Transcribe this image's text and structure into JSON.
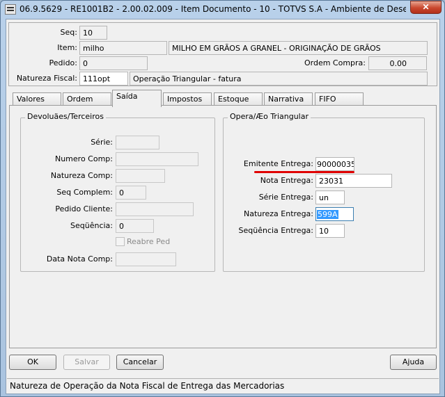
{
  "window": {
    "title": "06.9.5629 - RE1001B2 - 2.00.02.009 - Item Documento - 10 - TOTVS S.A - Ambiente de Desenvolviment...",
    "close_symbol": "✕"
  },
  "header": {
    "seq": {
      "label": "Seq:",
      "value": "10"
    },
    "item": {
      "label": "Item:",
      "value": "milho",
      "description": "MILHO EM GRÃOS A GRANEL - ORIGINAÇÃO DE GRÃOS"
    },
    "pedido": {
      "label": "Pedido:",
      "value": "0"
    },
    "ordem_compra": {
      "label": "Ordem Compra:",
      "value": "0.00"
    },
    "natureza_fiscal": {
      "label": "Natureza Fiscal:",
      "value": "111opt",
      "description": "Operação Triangular - fatura"
    }
  },
  "tabs": [
    {
      "label": "Valores"
    },
    {
      "label": "Ordem"
    },
    {
      "label": "Saída"
    },
    {
      "label": "Impostos"
    },
    {
      "label": "Estoque"
    },
    {
      "label": "Narrativa"
    },
    {
      "label": "FIFO"
    }
  ],
  "devolucoes": {
    "title": "Devoluäes/Terceiros",
    "serie": {
      "label": "Série:",
      "value": ""
    },
    "numero_comp": {
      "label": "Numero Comp:",
      "value": ""
    },
    "natureza_comp": {
      "label": "Natureza Comp:",
      "value": ""
    },
    "seq_complem": {
      "label": "Seq Complem:",
      "value": "0"
    },
    "pedido_cliente": {
      "label": "Pedido Cliente:",
      "value": ""
    },
    "sequencia": {
      "label": "Seqüência:",
      "value": "0"
    },
    "reabre_ped": {
      "label": "Reabre Ped",
      "checked": false
    },
    "data_nota_comp": {
      "label": "Data Nota Comp:",
      "value": ""
    }
  },
  "triangular": {
    "title": "Opera/Æo Triangular",
    "emitente_entrega": {
      "label": "Emitente Entrega:",
      "value": "90000035"
    },
    "nota_entrega": {
      "label": "Nota Entrega:",
      "value": "23031"
    },
    "serie_entrega": {
      "label": "Série Entrega:",
      "value": "un"
    },
    "natureza_entrega": {
      "label": "Natureza Entrega:",
      "value": "599A"
    },
    "sequencia_entrega": {
      "label": "Seqüência Entrega:",
      "value": "10"
    }
  },
  "buttons": {
    "ok": "OK",
    "salvar": "Salvar",
    "cancelar": "Cancelar",
    "ajuda": "Ajuda"
  },
  "status_bar": "Natureza de Operação da Nota Fiscal de Entrega das Mercadorias",
  "colors": {
    "highlight_underline": "#e00000",
    "selection": "#3399ff"
  }
}
